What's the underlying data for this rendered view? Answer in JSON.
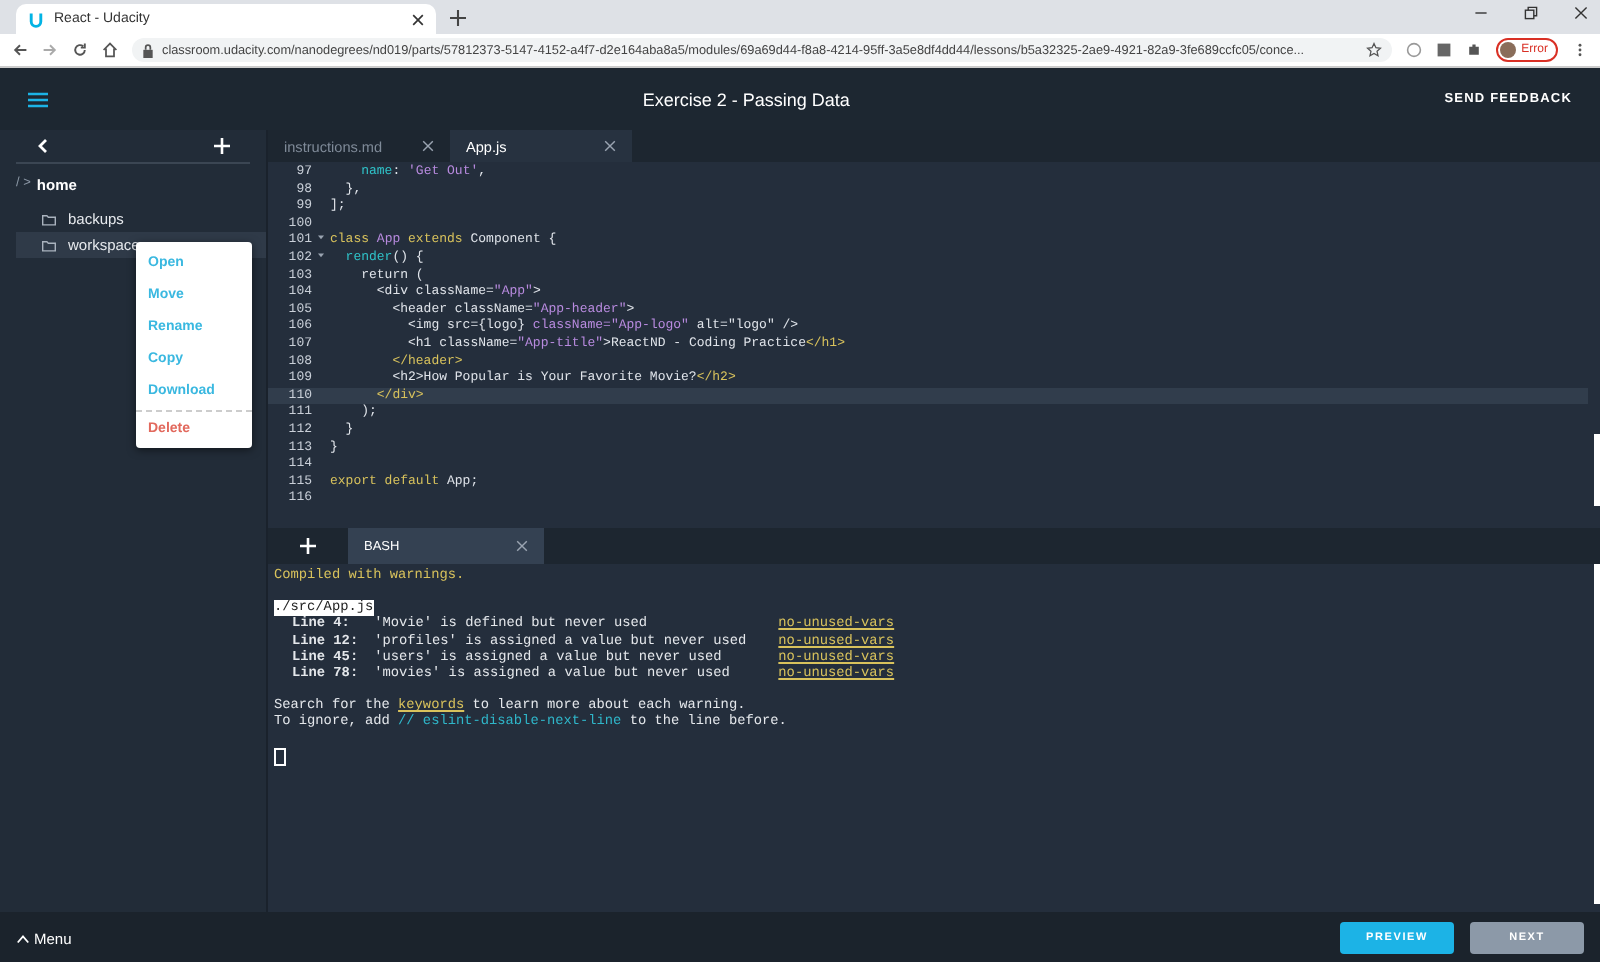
{
  "browser": {
    "tab_title": "React - Udacity",
    "url": "classroom.udacity.com/nanodegrees/nd019/parts/57812373-5147-4152-a4f7-d2e164aba8a5/modules/69a69d44-f8a8-4214-95ff-3a5e8df4dd44/lessons/b5a32325-2ae9-4921-82a9-3fe689ccfc05/conce...",
    "profile_status": "Error"
  },
  "header": {
    "title": "Exercise 2 - Passing Data",
    "feedback": "SEND FEEDBACK"
  },
  "sidebar": {
    "path_separator": "/ >",
    "path": "home",
    "items": [
      {
        "name": "backups",
        "selected": false
      },
      {
        "name": "workspace",
        "selected": true
      }
    ]
  },
  "context_menu": [
    {
      "label": "Open",
      "kind": "action"
    },
    {
      "label": "Move",
      "kind": "action"
    },
    {
      "label": "Rename",
      "kind": "action"
    },
    {
      "label": "Copy",
      "kind": "action"
    },
    {
      "label": "Download",
      "kind": "action"
    },
    {
      "label": "Delete",
      "kind": "danger"
    }
  ],
  "editor_tabs": [
    {
      "label": "instructions.md",
      "selected": false
    },
    {
      "label": "App.js",
      "selected": true
    }
  ],
  "code_lines": [
    {
      "num": "97",
      "fold": false,
      "current": false,
      "segments": [
        {
          "text": "    name",
          "color": "#2fc3c9"
        },
        {
          "text": ": "
        },
        {
          "text": "'Get Out'",
          "color": "#b98be0"
        },
        {
          "text": ","
        }
      ]
    },
    {
      "num": "98",
      "fold": false,
      "current": false,
      "segments": [
        {
          "text": "  },"
        }
      ]
    },
    {
      "num": "99",
      "fold": false,
      "current": false,
      "segments": [
        {
          "text": "];"
        }
      ]
    },
    {
      "num": "100",
      "fold": false,
      "current": false
    },
    {
      "num": "101",
      "fold": true,
      "current": false,
      "segments": [
        {
          "text": "class",
          "color": "#d8c25c"
        },
        {
          "text": " App",
          "color": "#b98be0"
        },
        {
          "text": " extends",
          "color": "#d8c25c"
        },
        {
          "text": " Component {"
        }
      ]
    },
    {
      "num": "102",
      "fold": true,
      "current": false,
      "segments": [
        {
          "text": "  render",
          "color": "#2fc3c9"
        },
        {
          "text": "() {"
        }
      ]
    },
    {
      "num": "103",
      "fold": false,
      "current": false,
      "segments": [
        {
          "text": "    return ("
        }
      ]
    },
    {
      "num": "104",
      "fold": false,
      "current": false,
      "segments": [
        {
          "text": "      <div className="
        },
        {
          "text": "\"App\"",
          "color": "#b98be0"
        },
        {
          "text": ">"
        }
      ]
    },
    {
      "num": "105",
      "fold": false,
      "current": false,
      "segments": [
        {
          "text": "        <header className="
        },
        {
          "text": "\"App-header\"",
          "color": "#b98be0"
        },
        {
          "text": ">"
        }
      ]
    },
    {
      "num": "106",
      "fold": false,
      "current": false,
      "segments": [
        {
          "text": "          <img src={logo}"
        },
        {
          "text": " className=\"App-logo\"",
          "color": "#b98be0"
        },
        {
          "text": " alt=\"logo\" />"
        }
      ]
    },
    {
      "num": "107",
      "fold": false,
      "current": false,
      "segments": [
        {
          "text": "          <h1 className="
        },
        {
          "text": "\"App-title\"",
          "color": "#b98be0"
        },
        {
          "text": ">ReactND - Coding Practice"
        },
        {
          "text": "</h1>",
          "color": "#d8c25c"
        }
      ]
    },
    {
      "num": "108",
      "fold": false,
      "current": false,
      "segments": [
        {
          "text": "        </header>",
          "color": "#d8c25c"
        }
      ]
    },
    {
      "num": "109",
      "fold": false,
      "current": false,
      "segments": [
        {
          "text": "        <h2>How Popular is Your Favorite Movie?"
        },
        {
          "text": "</h2>",
          "color": "#d8c25c"
        }
      ]
    },
    {
      "num": "110",
      "fold": false,
      "current": true,
      "segments": [
        {
          "text": "      </div>",
          "color": "#d8c25c"
        }
      ]
    },
    {
      "num": "111",
      "fold": false,
      "current": false,
      "segments": [
        {
          "text": "    );"
        }
      ]
    },
    {
      "num": "112",
      "fold": false,
      "current": false,
      "segments": [
        {
          "text": "  }"
        }
      ]
    },
    {
      "num": "113",
      "fold": false,
      "current": false,
      "segments": [
        {
          "text": "}"
        }
      ]
    },
    {
      "num": "114",
      "fold": false,
      "current": false
    },
    {
      "num": "115",
      "fold": false,
      "current": false,
      "segments": [
        {
          "text": "export default",
          "color": "#d8c25c"
        },
        {
          "text": " App;"
        }
      ]
    },
    {
      "num": "116",
      "fold": false,
      "current": false
    }
  ],
  "terminal_tabs": [
    {
      "label": "BASH",
      "selected": true
    }
  ],
  "terminal": {
    "status": "Compiled with warnings.",
    "file": "./src/App.js",
    "warnings": [
      {
        "line": "Line 4:",
        "message": "'Movie' is defined but never used",
        "rule": "no-unused-vars"
      },
      {
        "line": "Line 12:",
        "message": "'profiles' is assigned a value but never used",
        "rule": "no-unused-vars"
      },
      {
        "line": "Line 45:",
        "message": "'users' is assigned a value but never used",
        "rule": "no-unused-vars"
      },
      {
        "line": "Line 78:",
        "message": "'movies' is assigned a value but never used",
        "rule": "no-unused-vars"
      }
    ],
    "hints": [
      [
        {
          "text": "Search for the ",
          "color": "#e4e7eb",
          "link": false
        },
        {
          "text": "keywords",
          "color": "#d8c25c",
          "link": true
        },
        {
          "text": " to learn more about each warning.",
          "color": "#e4e7eb",
          "link": false
        }
      ],
      [
        {
          "text": "To ignore, add ",
          "color": "#e4e7eb",
          "link": false
        },
        {
          "text": "// eslint-disable-next-line",
          "color": "#2fb6c9",
          "link": false
        },
        {
          "text": " to the line before.",
          "color": "#e4e7eb",
          "link": false
        }
      ]
    ]
  },
  "footer": {
    "menu": "Menu",
    "buttons": [
      {
        "label": "PREVIEW",
        "disabled": false
      },
      {
        "label": "NEXT",
        "disabled": true
      }
    ]
  }
}
